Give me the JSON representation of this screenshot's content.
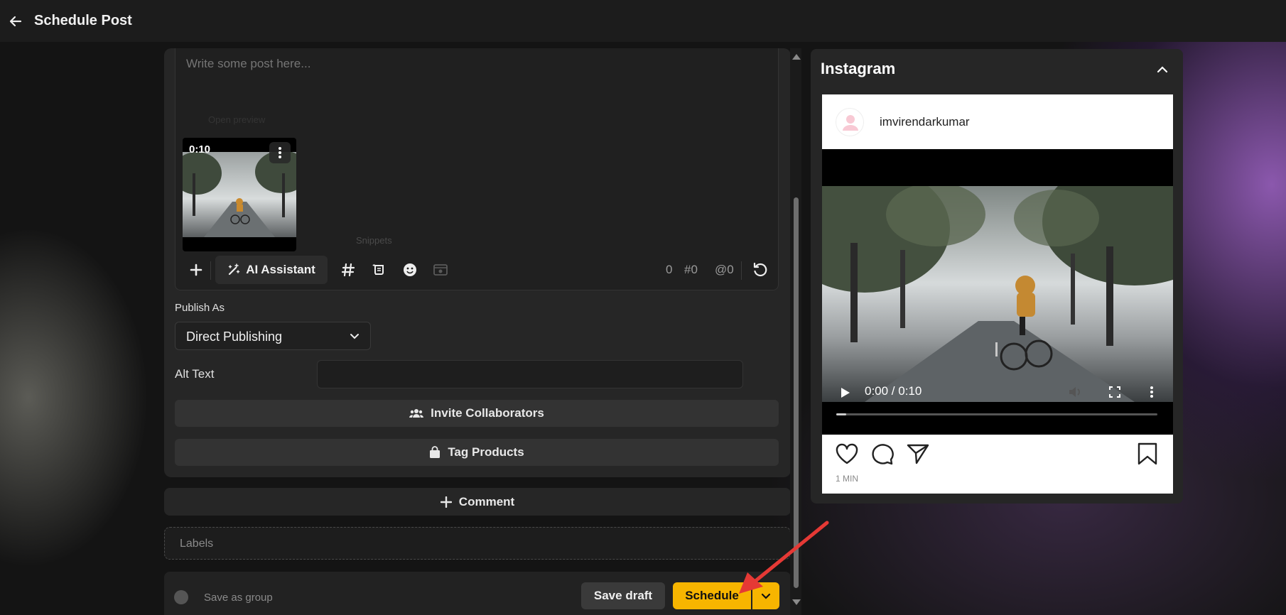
{
  "header": {
    "title": "Schedule Post"
  },
  "composer": {
    "placeholder": "Write some post here...",
    "ghost_open_preview": "Open preview",
    "ghost_snippets": "Snippets",
    "media": {
      "duration": "0:10"
    },
    "toolbar": {
      "ai_label": "AI Assistant",
      "char_count": "0",
      "hashtag_count": "#0",
      "mention_count": "@0"
    }
  },
  "publish_as": {
    "label": "Publish As",
    "value": "Direct Publishing"
  },
  "alt_text": {
    "label": "Alt Text",
    "value": ""
  },
  "buttons": {
    "invite": "Invite Collaborators",
    "tag_products": "Tag Products",
    "comment": "Comment"
  },
  "labels": {
    "placeholder": "Labels"
  },
  "footer": {
    "save_group": "Save as group",
    "save_draft": "Save draft",
    "schedule": "Schedule"
  },
  "preview": {
    "platform": "Instagram",
    "username": "imvirendarkumar",
    "video_time": "0:00 / 0:10",
    "video_progress": 0.03,
    "age": "1 MIN"
  },
  "colors": {
    "accent": "#f7b500",
    "annotation": "#e53935"
  }
}
